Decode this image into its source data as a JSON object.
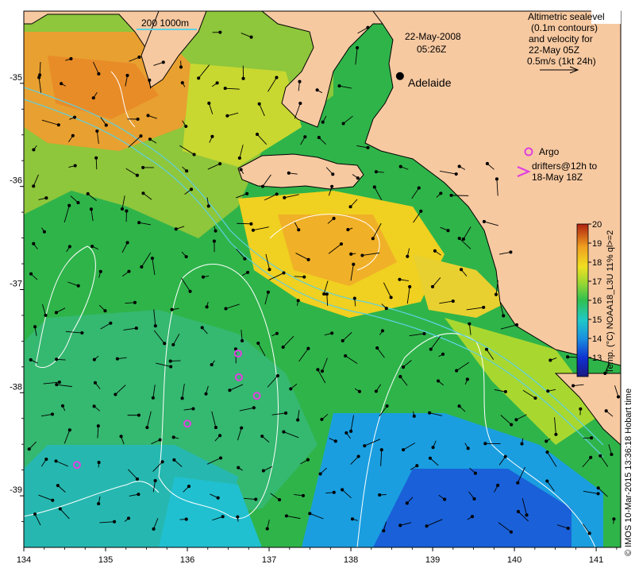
{
  "header": {
    "date": "22-May-2008",
    "time": "05:26Z"
  },
  "depth_scale_label": "200  1000m",
  "legend_velocity": {
    "lines": [
      "Altimetric sealevel",
      "(0.1m contours)",
      "and velocity for",
      "22-May 05Z",
      "0.5m/s (1kt 24h)"
    ]
  },
  "legend_argo": {
    "lines": [
      "Argo",
      "drifters@12h to",
      "18-May 18Z"
    ]
  },
  "city": {
    "name": "Adelaide",
    "lon": 138.6,
    "lat": -34.93
  },
  "colorbar": {
    "title": "Temp. (°C) NOAA18_L3U 11% ql>=2",
    "min": 12,
    "max": 20,
    "ticks": [
      "13",
      "14",
      "15",
      "16",
      "17",
      "18",
      "19",
      "20"
    ]
  },
  "credit": "© IMOS 10-Mar-2015 13:36:18 Hobart time",
  "axes": {
    "x_ticks": [
      "134",
      "135",
      "136",
      "137",
      "138",
      "139",
      "140",
      "141"
    ],
    "y_ticks": [
      "-35",
      "-36",
      "-37",
      "-38",
      "-39"
    ],
    "lon_range": [
      134,
      141.3
    ],
    "lat_range": [
      -34.3,
      -39.5
    ]
  },
  "argo_floats": [
    {
      "lon": 136.62,
      "lat": -37.62
    },
    {
      "lon": 136.63,
      "lat": -37.85
    },
    {
      "lon": 136.85,
      "lat": -38.03
    },
    {
      "lon": 136.0,
      "lat": -38.3
    },
    {
      "lon": 134.65,
      "lat": -38.7
    }
  ],
  "colors": {
    "land": "#f7c9a1",
    "coast": "#000000",
    "contour": "#ffffff",
    "argo": "#e040e0",
    "depth": "#5fd0e0"
  }
}
